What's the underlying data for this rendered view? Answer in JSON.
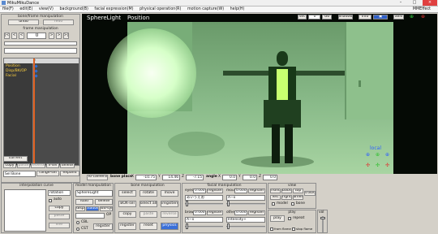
{
  "window": {
    "title": "MikuMikuDance",
    "app_label": "MMEffect"
  },
  "menu": [
    "file(F)",
    "edit(E)",
    "view(V)",
    "background(B)",
    "facial expression(M)",
    "physical operation(R)",
    "motion capture(W)",
    "help(H)"
  ],
  "frame_panel": {
    "title": "bone/frame manipulation",
    "undo": "undo",
    "redo": "redo",
    "frame_manip": "frame manipulation",
    "frame_value": "0",
    "frame_number": "5",
    "tracks": [
      "Position",
      "Disp/BK/OP",
      "Facial"
    ],
    "current": "current",
    "row1": [
      "copy",
      "paste",
      "reverse",
      "v-sel",
      "delete"
    ],
    "row2": [
      "range-sel",
      "expand"
    ],
    "sel_bone": "Sel Bone"
  },
  "viewport": {
    "model_name": "SphereLight",
    "bone_name": "Position",
    "set_label": "set",
    "frame_input": "0",
    "go": "Go",
    "shadow": "Shadow",
    "info": "info",
    "axis": "axis",
    "local": "local",
    "to_camera": "To camera",
    "bone_place": "bone place",
    "x_label": "X",
    "x_value": "-10.75",
    "y_label": "Y",
    "y_value": "14.46",
    "z_label": "Z",
    "z_value": "-7.15",
    "angle_label": "angle",
    "ax_label": "X",
    "ax_value": "0.0",
    "ay_label": "Y",
    "ay_value": "0.0",
    "az_label": "Z",
    "az_value": "0.0"
  },
  "interp": {
    "title": "interpolation curve",
    "dropdown": "rotation",
    "auto": "auto",
    "copy": "copy",
    "paste": "paste",
    "line": "line"
  },
  "model": {
    "title": "model manipulation",
    "selected": "SphereLight",
    "load": "load",
    "delete": "delete",
    "disp": "disp",
    "shadow": "shadow",
    "add_syn": "add-syn",
    "op": "OP",
    "cbl": "CBL",
    "cst": "CST",
    "register": "register"
  },
  "bone": {
    "title": "bone manipulation",
    "select": "select",
    "rotate": "rotate",
    "move": "move",
    "box_sel": "BOX-sel",
    "select_all": "select all",
    "unregistered": "unregistered",
    "copy": "copy",
    "paste": "paste",
    "reverse": "reverse",
    "register": "register",
    "reset": "reset",
    "physics": "physics"
  },
  "facial": {
    "title": "facial manipulation",
    "eyes_label": "eyes",
    "eyes_value": "0.000",
    "eyes_register": "register",
    "eyes_select": "あいうえお",
    "mouth_label": "mouth",
    "mouth_value": "0.000",
    "mouth_register": "register",
    "mouth_select": "Å−x",
    "brow_label": "brow",
    "brow_value": "0.000",
    "brow_register": "register",
    "brow_select": "Å−x",
    "other_label": "other",
    "other_value": "0.000",
    "other_register": "register",
    "other_select": "Intensity+"
  },
  "view": {
    "title": "view",
    "front": "front",
    "back": "back",
    "top": "top",
    "track": "track",
    "left": "left",
    "right": "right",
    "camera": "camera",
    "model": "model",
    "bone": "bone"
  },
  "play": {
    "title": "play",
    "play": "play",
    "repeat": "repeat",
    "from_flame": "from flame",
    "stop_flame": "stop flame",
    "vol": "vol"
  }
}
